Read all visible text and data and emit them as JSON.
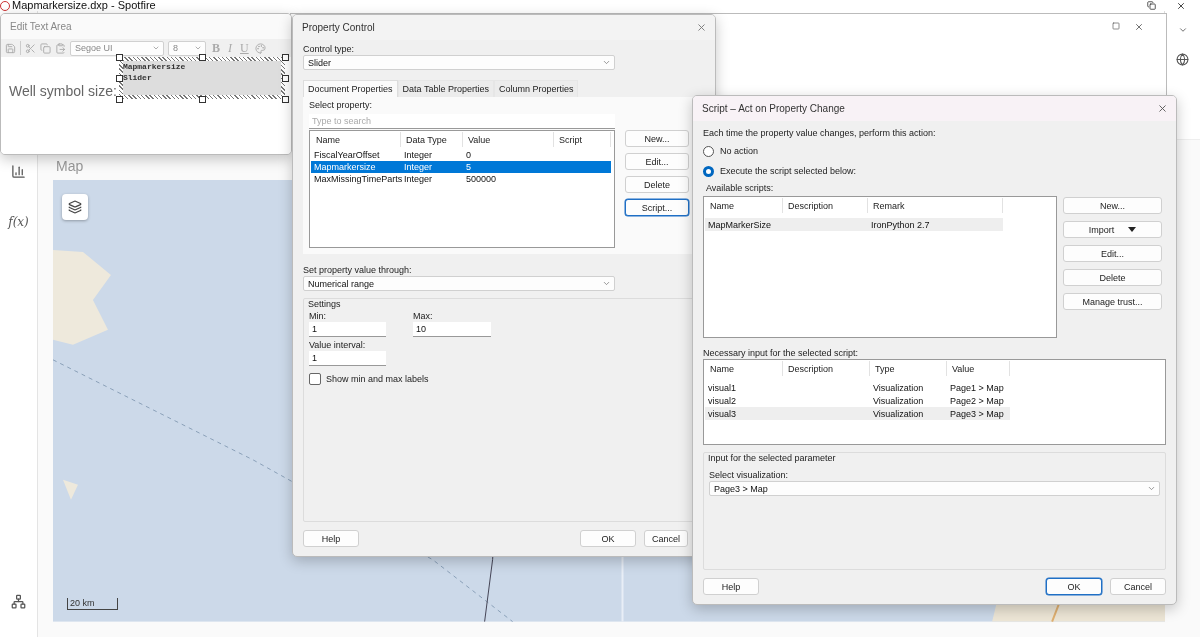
{
  "app": {
    "title": "Mapmarkersize.dxp - Spotfire"
  },
  "sidebar": {
    "formula_label": "f(x)"
  },
  "map_panel": {
    "title": "Map",
    "scale": "20 km"
  },
  "edit_text_area": {
    "title": "Edit Text Area",
    "font": "Segoe UI",
    "font_size": "8",
    "format_buttons": [
      {
        "label": "B",
        "kind": "bold"
      },
      {
        "label": "I",
        "kind": "italic"
      },
      {
        "label": "U",
        "kind": "underline"
      }
    ],
    "label": "Well symbol size:",
    "control": {
      "property": "Mapmarkersize",
      "type": "Slider"
    }
  },
  "property_control": {
    "title": "Property Control",
    "control_type_label": "Control type:",
    "control_type": "Slider",
    "tabs": [
      {
        "label": "Document Properties",
        "selected": true
      },
      {
        "label": "Data Table Properties",
        "selected": false
      },
      {
        "label": "Column Properties",
        "selected": false
      }
    ],
    "select_property_label": "Select property:",
    "search_placeholder": "Type to search",
    "columns": [
      "Name",
      "Data Type",
      "Value",
      "Script"
    ],
    "rows": [
      {
        "cells": [
          "FiscalYearOffset",
          "Integer",
          "0"
        ],
        "selected": false
      },
      {
        "cells": [
          "Mapmarkersize",
          "Integer",
          "5"
        ],
        "selected": true
      },
      {
        "cells": [
          "MaxMissingTimeParts",
          "Integer",
          "500000"
        ],
        "selected": false
      }
    ],
    "buttons": [
      {
        "label": "New...",
        "focused": false
      },
      {
        "label": "Edit...",
        "focused": false
      },
      {
        "label": "Delete",
        "focused": false
      },
      {
        "label": "Script...",
        "focused": true
      }
    ],
    "set_through_label": "Set property value through:",
    "set_through": "Numerical range",
    "settings": {
      "title": "Settings",
      "min_label": "Min:",
      "min": "1",
      "max_label": "Max:",
      "max": "10",
      "interval_label": "Value interval:",
      "interval": "1",
      "show_labels": {
        "label": "Show min and max labels",
        "checked": false
      }
    },
    "footer": [
      {
        "label": "Help",
        "focused": false
      },
      {
        "label": "OK",
        "focused": false
      },
      {
        "label": "Cancel",
        "focused": false
      }
    ]
  },
  "script_dialog": {
    "title": "Script – Act on Property Change",
    "prompt": "Each time the property value changes, perform this action:",
    "actions": [
      {
        "label": "No action",
        "selected": false
      },
      {
        "label": "Execute the script selected below:",
        "selected": true
      }
    ],
    "available_label": "Available scripts:",
    "script_columns": [
      "Name",
      "Description",
      "Remark"
    ],
    "scripts": [
      {
        "cells": [
          "MapMarkerSize",
          "",
          "IronPython 2.7"
        ],
        "selected": true
      }
    ],
    "buttons": [
      {
        "label": "New...",
        "kind": "plain"
      },
      {
        "label": "Import",
        "kind": "menu"
      },
      {
        "label": "Edit...",
        "kind": "plain"
      },
      {
        "label": "Delete",
        "kind": "plain"
      },
      {
        "label": "Manage trust...",
        "kind": "plain"
      }
    ],
    "input_label": "Necessary input for the selected script:",
    "input_columns": [
      "Name",
      "Description",
      "Type",
      "Value"
    ],
    "inputs": [
      {
        "cells": [
          "visual1",
          "",
          "Visualization",
          "Page1 > Map"
        ],
        "selected": false
      },
      {
        "cells": [
          "visual2",
          "",
          "Visualization",
          "Page2 > Map"
        ],
        "selected": false
      },
      {
        "cells": [
          "visual3",
          "",
          "Visualization",
          "Page3 > Map"
        ],
        "selected": true
      }
    ],
    "parameter_group": "Input for the selected parameter",
    "select_label": "Select visualization:",
    "visualization": "Page3 > Map",
    "footer": [
      {
        "label": "Help",
        "focused": false
      },
      {
        "label": "OK",
        "focused": true
      },
      {
        "label": "Cancel",
        "focused": false
      }
    ]
  }
}
